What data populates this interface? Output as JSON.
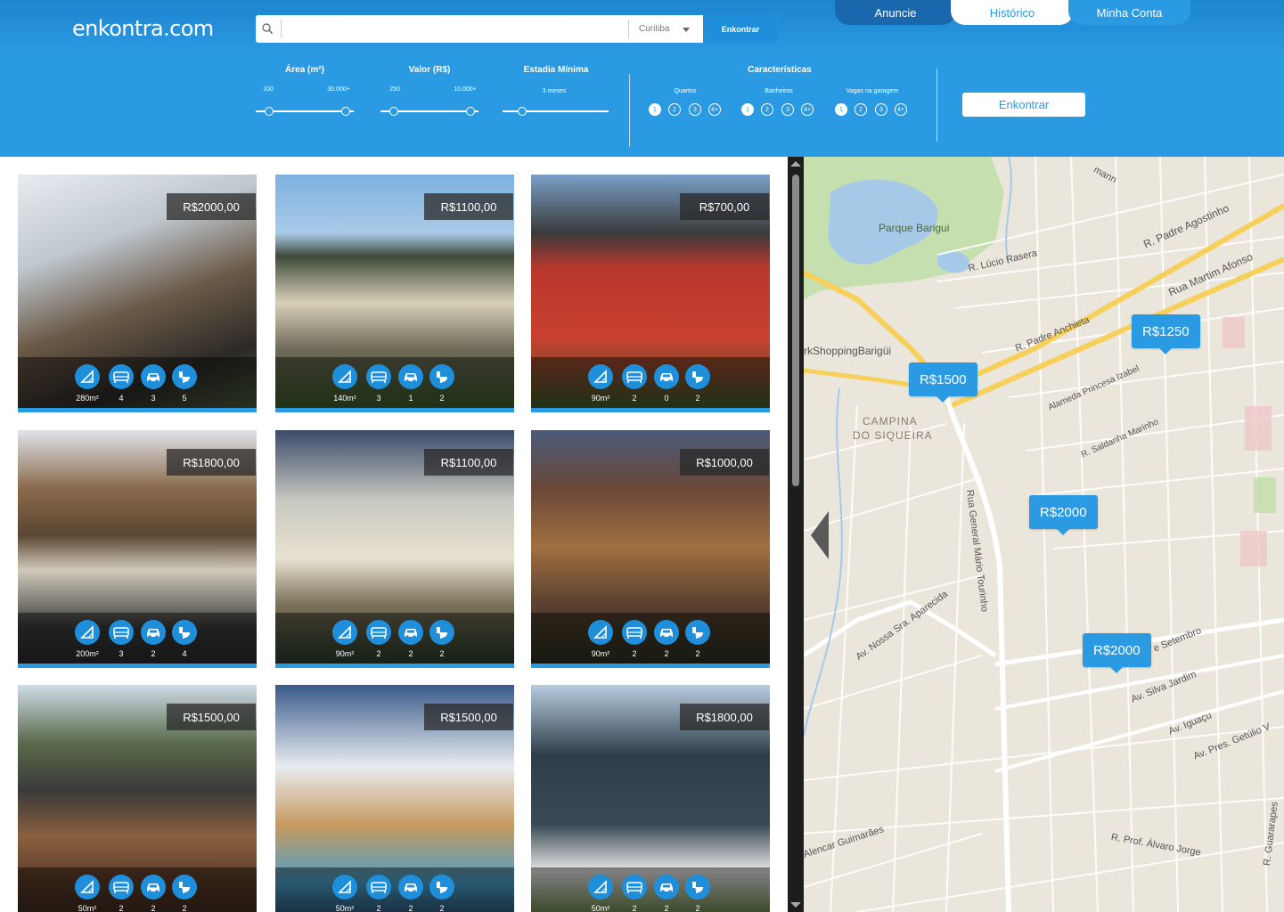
{
  "header": {
    "logo": "enkontra.com",
    "search": {
      "placeholder": "",
      "city": "Curitiba",
      "button": "Enkontrar"
    },
    "tabs": [
      "Anuncie",
      "Histórico",
      "Minha Conta"
    ],
    "filters": {
      "area": {
        "title": "Área (m²)",
        "min": "100",
        "max": "30.000+"
      },
      "valor": {
        "title": "Valor (R$)",
        "min": "250",
        "max": "10.000+"
      },
      "estadia": {
        "title": "Estadia Mínima",
        "value": "3 meses"
      },
      "caracteristicas": {
        "title": "Características",
        "quartos": "Quartos",
        "banheiros": "Banheiros",
        "vagas": "Vagas na garagem",
        "options": [
          "1",
          "2",
          "3",
          "4+"
        ]
      }
    },
    "submit": "Enkontrar"
  },
  "listings": [
    {
      "price": "R$2000,00",
      "area": "280m²",
      "beds": "4",
      "cars": "3",
      "baths": "5"
    },
    {
      "price": "R$1100,00",
      "area": "140m²",
      "beds": "3",
      "cars": "1",
      "baths": "2"
    },
    {
      "price": "R$700,00",
      "area": "90m²",
      "beds": "2",
      "cars": "0",
      "baths": "2"
    },
    {
      "price": "R$1800,00",
      "area": "200m²",
      "beds": "3",
      "cars": "2",
      "baths": "4"
    },
    {
      "price": "R$1100,00",
      "area": "90m²",
      "beds": "2",
      "cars": "2",
      "baths": "2"
    },
    {
      "price": "R$1000,00",
      "area": "90m²",
      "beds": "2",
      "cars": "2",
      "baths": "2"
    },
    {
      "price": "R$1500,00",
      "area": "50m²",
      "beds": "2",
      "cars": "2",
      "baths": "2"
    },
    {
      "price": "R$1500,00",
      "area": "50m²",
      "beds": "2",
      "cars": "2",
      "baths": "2"
    },
    {
      "price": "R$1800,00",
      "area": "50m²",
      "beds": "2",
      "cars": "2",
      "baths": "2"
    }
  ],
  "map": {
    "pins": [
      "R$1500",
      "R$1250",
      "R$2000",
      "R$2000"
    ],
    "labels": {
      "park": "Parque Barigui",
      "mall": "rkShoppingBarigüi",
      "district": [
        "CAMPINA",
        "DO SIQUEIRA"
      ],
      "streets": [
        "R. Padre Agostinho",
        "Rua Martim Afonso",
        "R. Lúcio Rasera",
        "R. Padre Anchieta",
        "Alameda Princesa Izabel",
        "R. Saldanha Marinho",
        "Rua General Mário Tourinho",
        "Av. Nossa Sra. Aparecida",
        "e Setembro",
        "Av. Silva Jardim",
        "Av. Iguaçu",
        "Av. Pres. Getúlio V",
        "R. Prof. Álvaro Jorge",
        "Alencar Guimarães",
        "R. Guararapes",
        "mann"
      ]
    }
  }
}
